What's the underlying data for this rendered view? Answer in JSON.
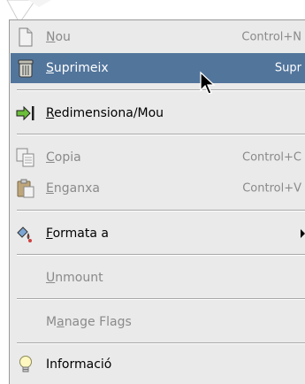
{
  "menu": {
    "items": [
      {
        "id": "nou",
        "label_pre": "",
        "mnemonic": "N",
        "label_post": "ou",
        "accel": "Control+N",
        "icon": "new-document-icon",
        "enabled": false,
        "highlighted": false
      },
      {
        "id": "suprimeix",
        "label_pre": "",
        "mnemonic": "S",
        "label_post": "uprimeix",
        "accel": "Supr",
        "icon": "trash-can-icon",
        "enabled": true,
        "highlighted": true
      },
      {
        "id": "redimensiona",
        "label_pre": "",
        "mnemonic": "R",
        "label_post": "edimensiona/Mou",
        "accel": "",
        "icon": "resize-arrow-icon",
        "enabled": true,
        "highlighted": false
      },
      {
        "id": "copia",
        "label_pre": "",
        "mnemonic": "C",
        "label_post": "opia",
        "accel": "Control+C",
        "icon": "copy-icon",
        "enabled": false,
        "highlighted": false
      },
      {
        "id": "enganxa",
        "label_pre": "",
        "mnemonic": "E",
        "label_post": "nganxa",
        "accel": "Control+V",
        "icon": "paste-icon",
        "enabled": false,
        "highlighted": false
      },
      {
        "id": "formata",
        "label_pre": "",
        "mnemonic": "F",
        "label_post": "ormata a",
        "accel": "",
        "icon": "format-paint-icon",
        "enabled": true,
        "highlighted": false,
        "submenu": true
      },
      {
        "id": "unmount",
        "label_pre": "",
        "mnemonic": "U",
        "label_post": "nmount",
        "accel": "",
        "icon": "",
        "enabled": false,
        "highlighted": false
      },
      {
        "id": "manage",
        "label_pre": "M",
        "mnemonic": "a",
        "label_post": "nage Flags",
        "accel": "",
        "icon": "",
        "enabled": false,
        "highlighted": false
      },
      {
        "id": "informacio",
        "label_pre": "",
        "mnemonic": "",
        "label_post": "Informació",
        "accel": "",
        "icon": "lightbulb-icon",
        "enabled": true,
        "highlighted": false
      }
    ]
  },
  "colors": {
    "menu_background": "#eaeaea",
    "highlight": "#52759c",
    "disabled_text": "#8a8a8a"
  }
}
